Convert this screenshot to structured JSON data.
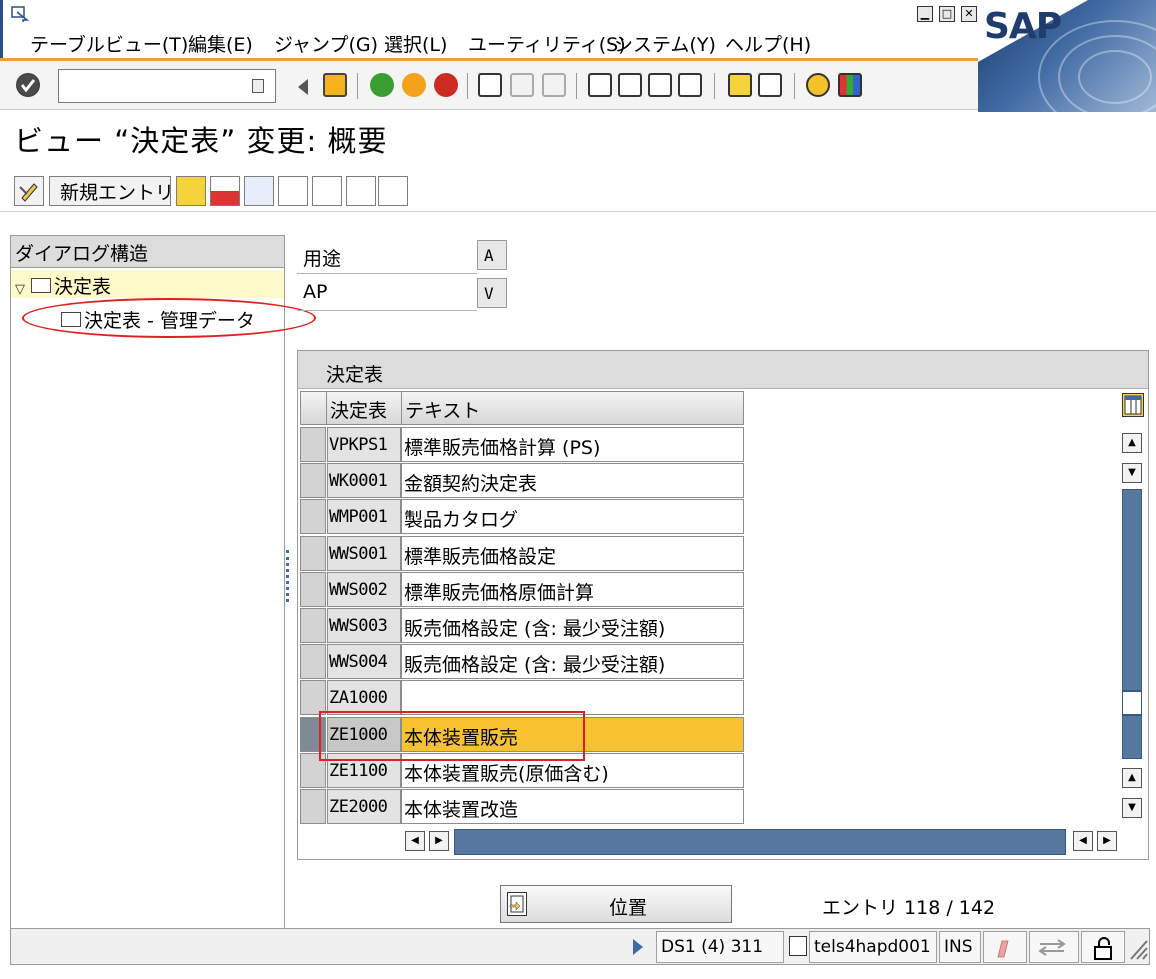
{
  "menu": [
    "テーブルビュー(T)",
    "編集(E)",
    "ジャンプ(G)",
    "選択(L)",
    "ユーティリティ(S)",
    "システム(Y)",
    "ヘルプ(H)"
  ],
  "brand": "SAP",
  "command_field": {
    "value": ""
  },
  "page_title": "ビュー “決定表” 変更: 概要",
  "app_toolbar": {
    "new_entries_label": "新規エントリ"
  },
  "tree": {
    "header": "ダイアログ構造",
    "root_label": "決定表",
    "child_label": "決定表 - 管理データ"
  },
  "fields": [
    {
      "label": "用途",
      "value": "A"
    },
    {
      "label": "AP",
      "value": "V"
    }
  ],
  "table": {
    "title": "決定表",
    "columns": [
      "決定表",
      "テキスト"
    ],
    "rows": [
      {
        "code": "VPKPS1",
        "text": "標準販売価格計算 (PS)"
      },
      {
        "code": "WK0001",
        "text": "金額契約決定表"
      },
      {
        "code": "WMP001",
        "text": "製品カタログ"
      },
      {
        "code": "WWS001",
        "text": "標準販売価格設定"
      },
      {
        "code": "WWS002",
        "text": "標準販売価格原価計算"
      },
      {
        "code": "WWS003",
        "text": "販売価格設定 (含: 最少受注額)"
      },
      {
        "code": "WWS004",
        "text": "販売価格設定 (含: 最少受注額)"
      },
      {
        "code": "ZA1000",
        "text": ""
      },
      {
        "code": "ZE1000",
        "text": "本体装置販売"
      },
      {
        "code": "ZE1100",
        "text": "本体装置販売(原価含む)"
      },
      {
        "code": "ZE2000",
        "text": "本体装置改造"
      }
    ],
    "selected_row": 8
  },
  "position_button_label": "位置",
  "entry_label": "エントリ 118 / 142",
  "status": {
    "system": "DS1 (4) 311",
    "server": "tels4hapd001",
    "mode": "INS"
  },
  "colors": {
    "selection": "#f8c230",
    "accent": "#f0a030",
    "highlight_annotation": "#e02020",
    "scroll": "#56779e"
  }
}
